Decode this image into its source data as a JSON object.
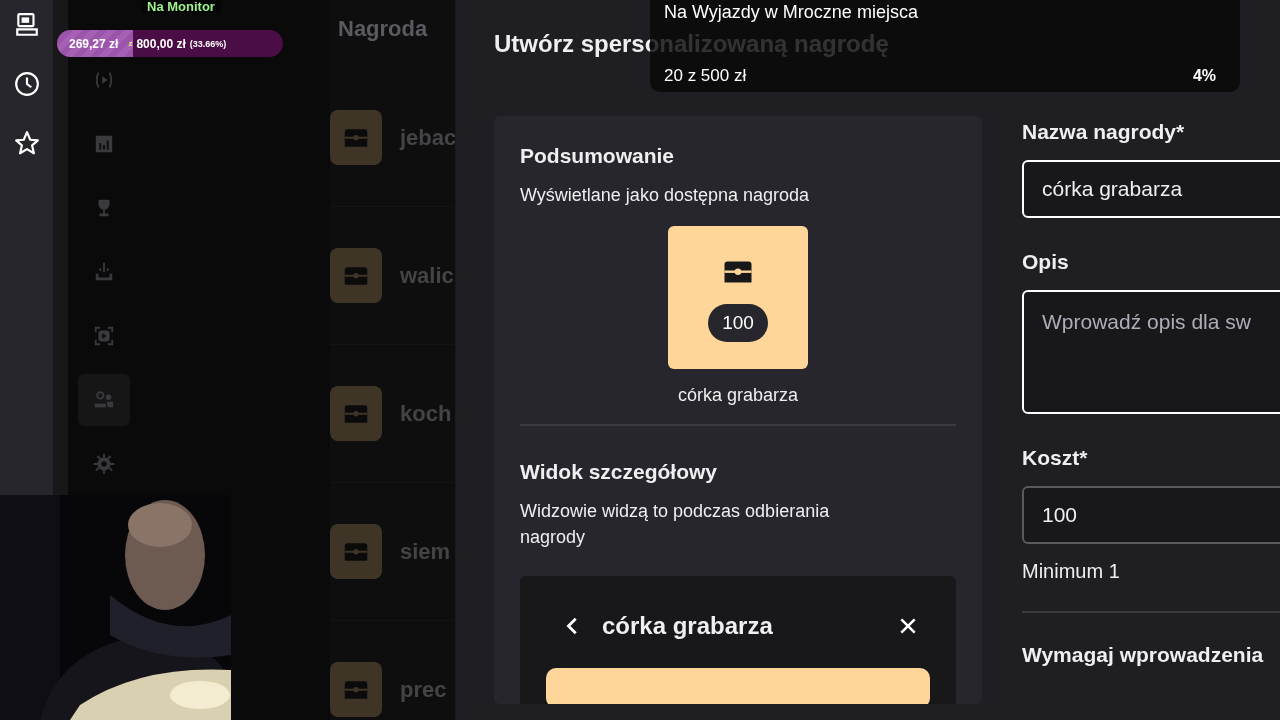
{
  "stream_overlay": {
    "label": "Na Monitor",
    "goal_bar": {
      "raised": "269,27 zł",
      "separator": "z",
      "target": "800,00 zł",
      "percent": "(33.66%)",
      "level": 0.3366
    },
    "goal_widget": {
      "title": "Na Wyjazdy w Mroczne miejsca",
      "progress": "20 z 500 zł",
      "percent": "4%"
    }
  },
  "side_rail": [
    {
      "kind": "monitor"
    },
    {
      "kind": "clock"
    },
    {
      "kind": "star"
    }
  ],
  "background_page": {
    "heading": "Nagroda",
    "nav": [
      {
        "kind": "play",
        "selected": false
      },
      {
        "kind": "chart",
        "selected": false
      },
      {
        "kind": "trophy",
        "selected": false
      },
      {
        "kind": "download",
        "selected": false
      },
      {
        "kind": "capture",
        "selected": false
      },
      {
        "kind": "people",
        "selected": true
      },
      {
        "kind": "gear",
        "selected": false
      }
    ],
    "rewards": [
      {
        "name": "jebac"
      },
      {
        "name": "walic"
      },
      {
        "name": "koch"
      },
      {
        "name": "siem"
      },
      {
        "name": "prec"
      }
    ]
  },
  "modal": {
    "title": "Utwórz spersonalizowaną nagrodę",
    "summary": {
      "heading": "Podsumowanie",
      "description": "Wyświetlane jako dostępna nagroda",
      "cost": "100",
      "name": "córka grabarza"
    },
    "detail": {
      "heading": "Widok szczegółowy",
      "description": "Widzowie widzą to podczas odbierania nagrody",
      "title": "córka grabarza"
    },
    "form": {
      "name_label": "Nazwa nagrody*",
      "name_value": "córka grabarza",
      "description_label": "Opis",
      "description_placeholder": "Wprowadź opis dla sw",
      "cost_label": "Koszt*",
      "cost_value": "100",
      "cost_hint": "Minimum 1",
      "input_label": "Wymagaj wprowadzenia"
    }
  }
}
